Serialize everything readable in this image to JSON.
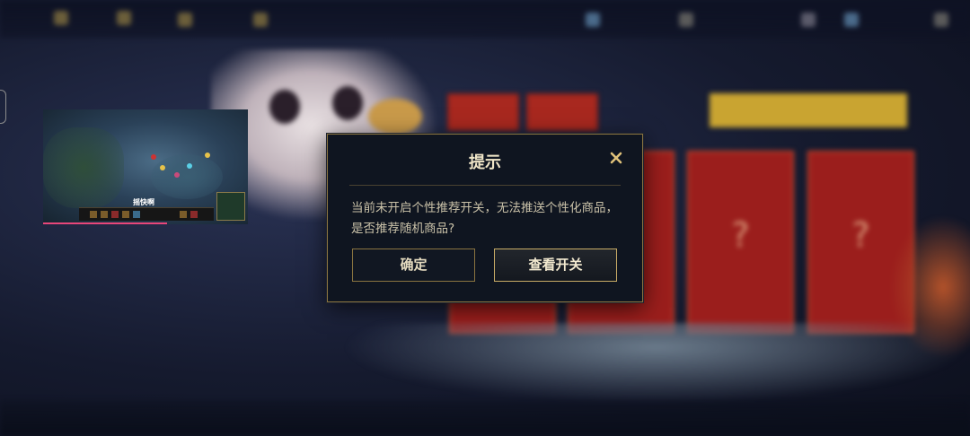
{
  "dialog": {
    "title": "提示",
    "message": "当前未开启个性推荐开关，无法推送个性化商品，是否推荐随机商品?",
    "confirm_label": "确定",
    "view_switch_label": "查看开关",
    "close_icon": "close-icon"
  },
  "video": {
    "caption": "摇快啊"
  },
  "colors": {
    "accent_gold": "#c8ab66",
    "dialog_bg": "#0f1520",
    "card_red": "#9b1e1c",
    "video_progress": "#e8467a"
  },
  "cards": [
    {
      "symbol": "?"
    },
    {
      "symbol": "?"
    }
  ]
}
